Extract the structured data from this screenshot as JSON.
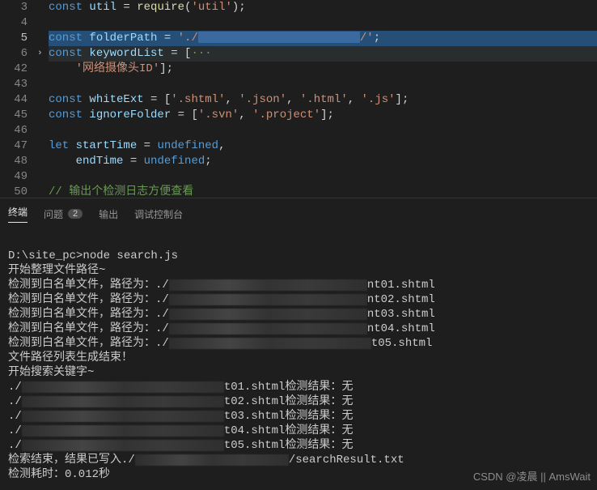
{
  "gutter": {
    "lines": [
      "3",
      "4",
      "5",
      "6",
      "42",
      "43",
      "44",
      "45",
      "46",
      "47",
      "48",
      "49",
      "50"
    ],
    "active": "5"
  },
  "code": {
    "l3": {
      "kw": "const",
      "var": "util",
      "eq": " = ",
      "fn": "require",
      "open": "(",
      "str": "'util'",
      "close": ");"
    },
    "l5": {
      "kw": "const",
      "var": "folderPath",
      "eq": " = ",
      "str1": "'./",
      "str2": "/'",
      "semi": ";"
    },
    "l6": {
      "kw": "const",
      "var": "keywordList",
      "eq": " = [",
      "dots": "···"
    },
    "l42": {
      "str": "'网络摄像头ID'",
      "close": "];"
    },
    "l44": {
      "kw": "const",
      "var": "whiteExt",
      "eq": " = [",
      "items": [
        "'.shtml'",
        "'.json'",
        "'.html'",
        "'.js'"
      ],
      "close": "];"
    },
    "l45": {
      "kw": "const",
      "var": "ignoreFolder",
      "eq": " = [",
      "items": [
        "'.svn'",
        "'.project'"
      ],
      "close": "];"
    },
    "l47": {
      "kw": "let",
      "var": "startTime",
      "eq": " = ",
      "val": "undefined",
      "end": ","
    },
    "l48": {
      "var": "endTime",
      "eq": " = ",
      "val": "undefined",
      "end": ";"
    },
    "l50": {
      "comment": "// 输出个检测日志方便查看"
    }
  },
  "tabs": {
    "terminal": "终端",
    "problems": "问题",
    "problemsCount": "2",
    "output": "输出",
    "debug": "调试控制台"
  },
  "terminal": {
    "prompt": "D:\\site_pc>node search.js",
    "start": "开始整理文件路径~",
    "whitePrefix": "检测到白名单文件，路径为：./",
    "whiteFiles": [
      "nt01.shtml",
      "nt02.shtml",
      "nt03.shtml",
      "nt04.shtml",
      "t05.shtml"
    ],
    "listDone": "文件路径列表生成结束！",
    "searchStart": "开始搜索关键字~",
    "resultPrefix": "./",
    "resultFiles": [
      "t01.shtml",
      "t02.shtml",
      "t03.shtml",
      "t04.shtml",
      "t05.shtml"
    ],
    "resultLabel": "检测结果：",
    "resultValue": "无",
    "searchDone1": "检索结束，结果已写入./",
    "searchDone2": "/searchResult.txt",
    "elapsed": "检测耗时：",
    "elapsedVal": "0.012秒"
  },
  "watermark": "CSDN @凌晨 || AmsWait"
}
